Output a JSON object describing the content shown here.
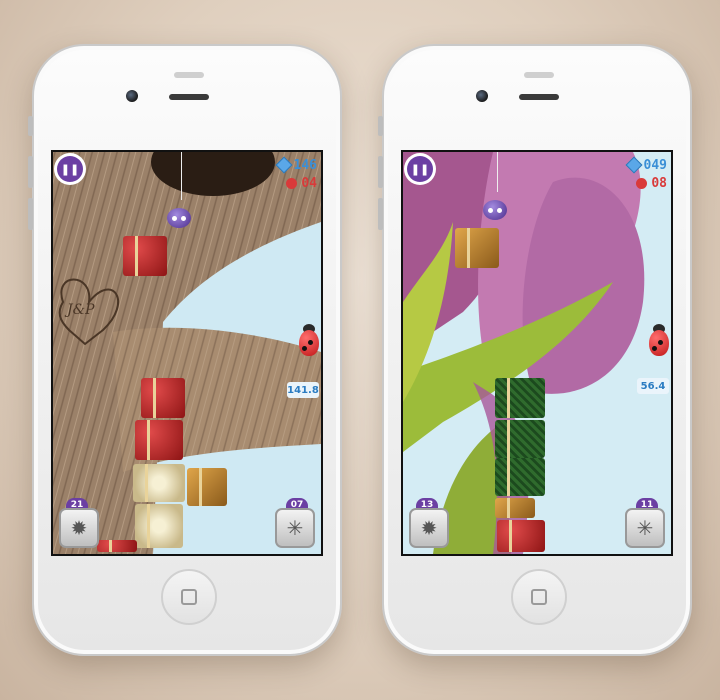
{
  "screens": [
    {
      "id": "left",
      "hud": {
        "pause_icon": "pause-icon",
        "blocks": "146",
        "lives": "04",
        "distance": "141.8",
        "power_left_count": "21",
        "power_right_count": "07"
      },
      "carving_text": "J&P",
      "theme": {
        "sky": "#cfe9f3",
        "scenery": "tree-branch"
      }
    },
    {
      "id": "right",
      "hud": {
        "pause_icon": "pause-icon",
        "blocks": "049",
        "lives": "08",
        "distance": "56.4",
        "power_left_count": "13",
        "power_right_count": "11"
      },
      "theme": {
        "sky": "#cfe9f3",
        "scenery": "tulip"
      }
    }
  ],
  "colors": {
    "hud_blue": "#3a8fd6",
    "hud_red": "#d93a3a",
    "accent_purple": "#6b3fa3"
  },
  "icons": {
    "blocks": "gem-icon",
    "lives": "paw-icon",
    "power_left": "shuriken-icon",
    "power_right": "spiderweb-icon"
  }
}
